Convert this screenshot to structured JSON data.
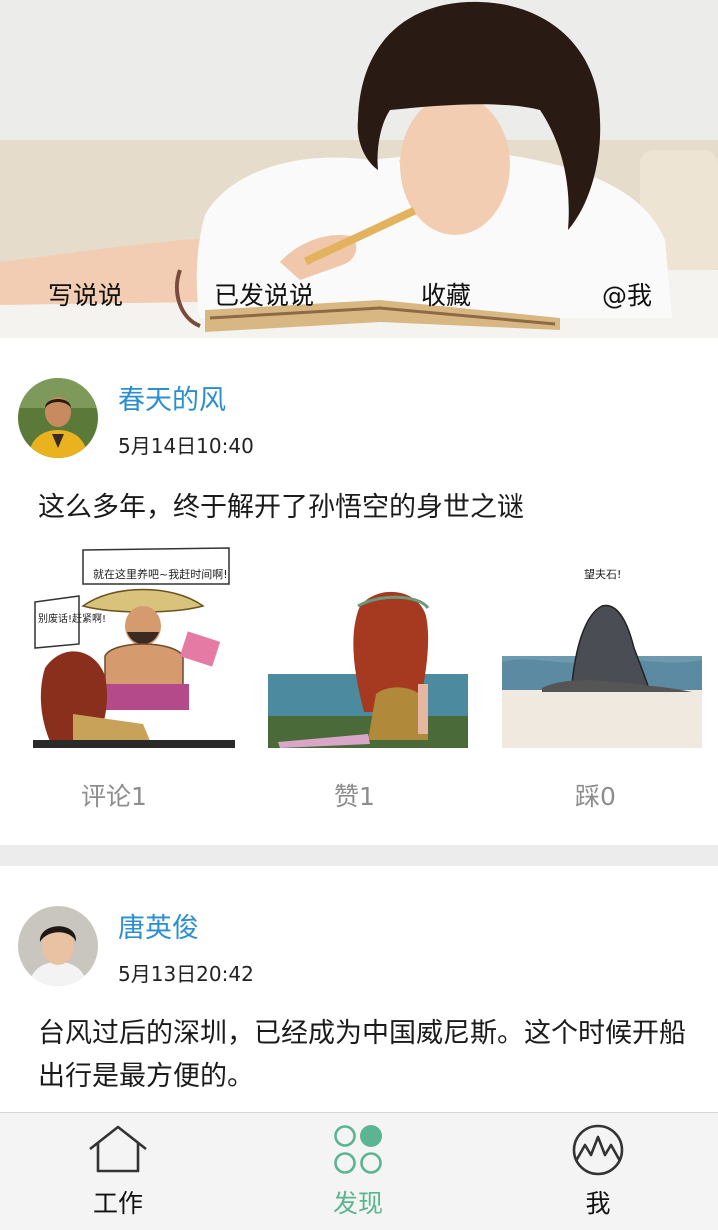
{
  "header": {
    "tabs": [
      {
        "label": "写说说"
      },
      {
        "label": "已发说说"
      },
      {
        "label": "收藏"
      },
      {
        "label": "@我"
      }
    ]
  },
  "feed": [
    {
      "author": "春天的风",
      "time": "5月14日10:40",
      "text": "这么多年，终于解开了孙悟空的身世之谜",
      "images": [
        {
          "caption_top": "就在这里养吧~我赶时间啊!",
          "caption_side": "别废话!赶紧啊!"
        },
        {
          "caption_top": ""
        },
        {
          "caption_top": "望夫石!"
        }
      ],
      "actions": {
        "comment": "评论1",
        "like": "赞1",
        "dislike": "踩0"
      }
    },
    {
      "author": "唐英俊",
      "time": "5月13日20:42",
      "text": "台风过后的深圳，已经成为中国威尼斯。这个时候开船出行是最方便的。"
    }
  ],
  "bottom_nav": {
    "items": [
      {
        "label": "工作",
        "icon": "house-icon"
      },
      {
        "label": "发现",
        "icon": "discover-icon",
        "active": true
      },
      {
        "label": "我",
        "icon": "profile-icon"
      }
    ],
    "active_color": "#5bb492"
  }
}
